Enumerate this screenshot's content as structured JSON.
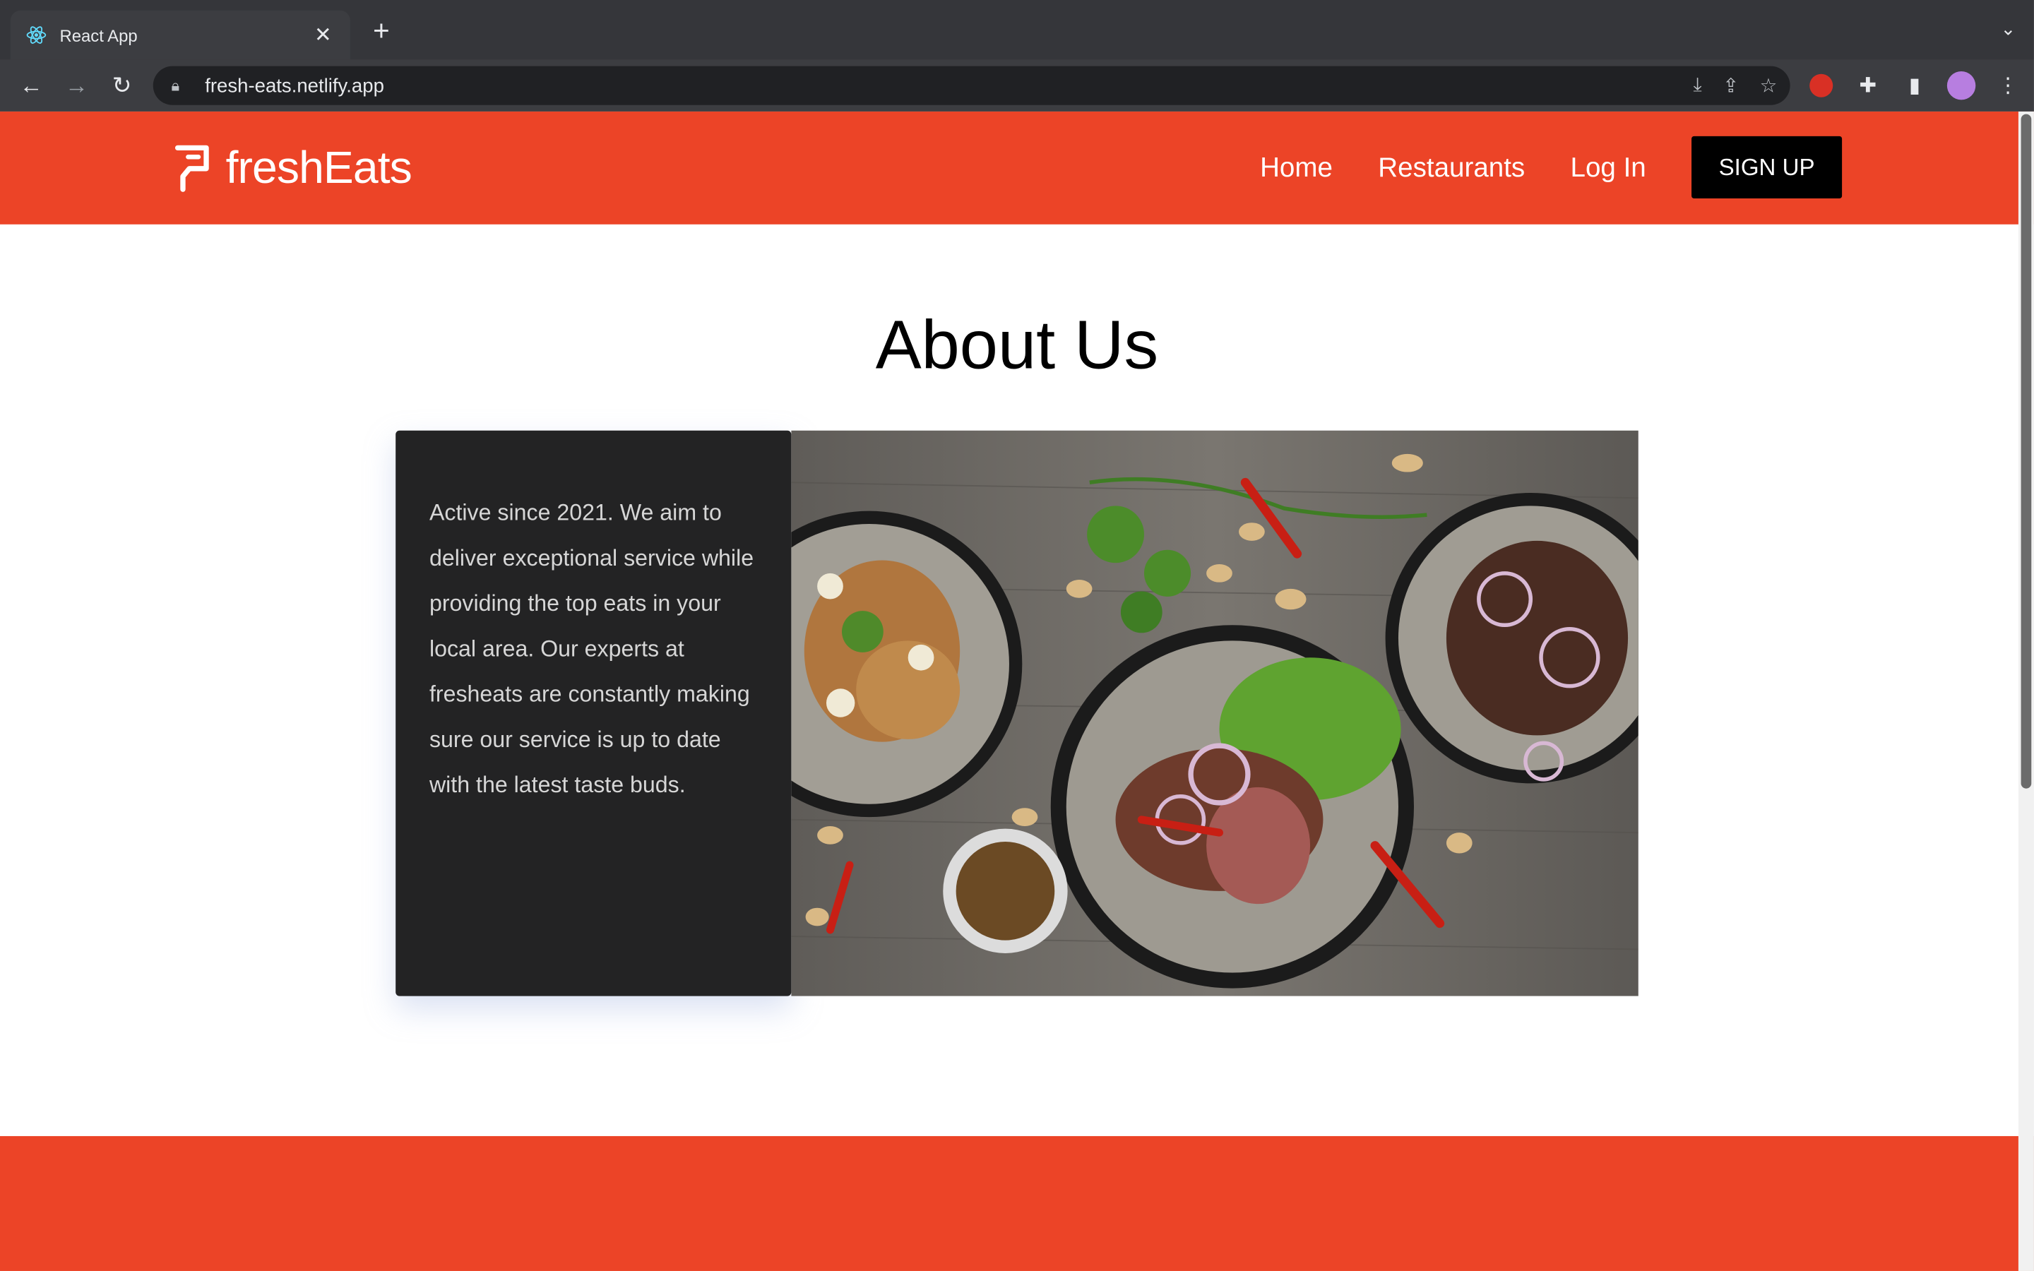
{
  "browser": {
    "tab_title": "React App",
    "url": "fresh-eats.netlify.app"
  },
  "site": {
    "brand": "freshEats",
    "nav": {
      "home": "Home",
      "restaurants": "Restaurants",
      "login": "Log In",
      "signup": "SIGN UP"
    },
    "colors": {
      "accent": "#ec4427",
      "card_bg": "#232324"
    }
  },
  "about": {
    "title": "About Us",
    "text": "Active since 2021. We aim to deliver exceptional service while providing the top eats in your local area. Our experts at fresheats are constantly making sure our service is up to date with the latest taste buds."
  }
}
